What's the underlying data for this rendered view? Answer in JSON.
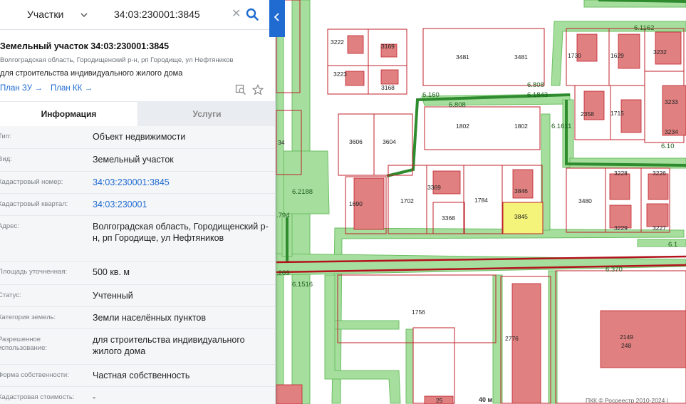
{
  "search": {
    "type_label": "Участки",
    "value": "34:03:230001:3845"
  },
  "card": {
    "title": "Земельный участок 34:03:230001:3845",
    "address": "Волгоградская область, Городищенский р-н, рп Городище, ул Нефтяников",
    "purpose": "для строительства индивидуального жилого дома",
    "link_zu": "План ЗУ →",
    "link_kk": "План КК →"
  },
  "tabs": [
    {
      "label": "Информация",
      "active": true
    },
    {
      "label": "Услуги",
      "active": false
    }
  ],
  "info_rows": [
    {
      "label": "Тип:",
      "value": "Объект недвижимости",
      "link": false
    },
    {
      "label": "Вид:",
      "value": "Земельный участок",
      "link": false
    },
    {
      "label": "Кадастровый номер:",
      "value": "34:03:230001:3845",
      "link": true
    },
    {
      "label": "Кадастровый квартал:",
      "value": "34:03:230001",
      "link": true
    },
    {
      "label": "Адрес:",
      "value": "Волгоградская область, Городищенский р-н, рп Городище, ул Нефтяников",
      "link": false
    },
    {
      "label": "Площадь уточненная:",
      "value": "500 кв. м",
      "link": false
    },
    {
      "label": "Статус:",
      "value": "Учтенный",
      "link": false
    },
    {
      "label": "Категория земель:",
      "value": "Земли населённых пунктов",
      "link": false
    },
    {
      "label": "Разрешенное использование:",
      "value": "для строительства индивидуального жилого дома",
      "link": false
    },
    {
      "label": "Форма собственности:",
      "value": "Частная собственность",
      "link": false
    },
    {
      "label": "Кадастровая стоимость:",
      "value": "-",
      "link": false
    }
  ],
  "map": {
    "selected_parcel": "3845",
    "scale": "40 м",
    "copyright": "ПКК © Росреестр 2010-2024 |"
  },
  "colors": {
    "accent": "#1f6bd1",
    "selected_fill": "#f4f37a",
    "parcel_border": "#c0202a",
    "building": "#e08080",
    "road": "#8fd18a"
  }
}
